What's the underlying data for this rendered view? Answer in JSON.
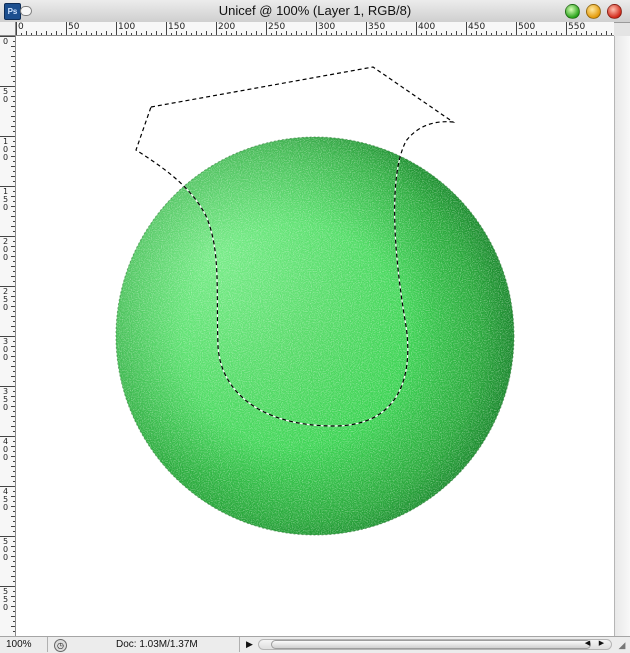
{
  "window": {
    "title": "Unicef @ 100% (Layer 1, RGB/8)",
    "app_icon_text": "Ps"
  },
  "rulers": {
    "horizontal_labels": [
      "0",
      "50",
      "100",
      "150",
      "200",
      "250",
      "300",
      "350",
      "400",
      "450",
      "500",
      "550"
    ],
    "vertical_labels": [
      "0",
      "50",
      "100",
      "150",
      "200",
      "250",
      "300",
      "350",
      "400",
      "450",
      "500",
      "550"
    ]
  },
  "canvas": {
    "object": "green-textured-sphere",
    "colors": {
      "highlight": "#8cff9a",
      "mid": "#34c94a",
      "shadow": "#0e6a1e",
      "background": "#ffffff"
    }
  },
  "status": {
    "zoom": "100%",
    "doc_info": "Doc: 1.03M/1.37M",
    "arrow_right": "▶",
    "arrow_left": "◀",
    "arrow_scroll_right": "▶"
  },
  "icons": {
    "close": "close-icon",
    "minimize": "minimize-icon",
    "zoom": "zoom-icon"
  }
}
